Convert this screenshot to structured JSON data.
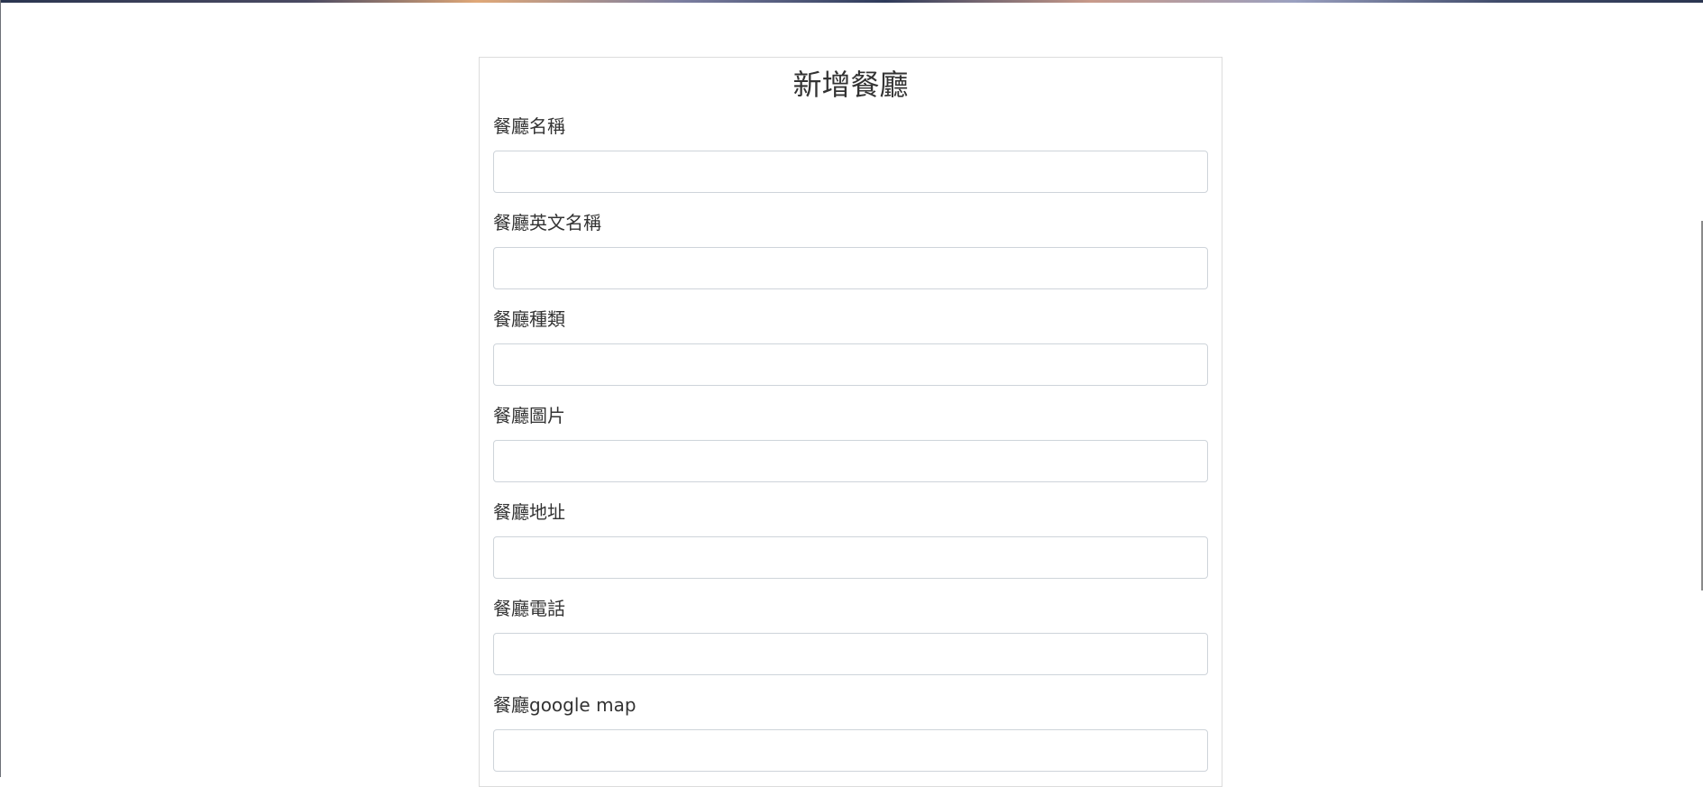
{
  "form": {
    "title": "新增餐廳",
    "fields": [
      {
        "label": "餐廳名稱",
        "value": "",
        "placeholder": ""
      },
      {
        "label": "餐廳英文名稱",
        "value": "",
        "placeholder": ""
      },
      {
        "label": "餐廳種類",
        "value": "",
        "placeholder": ""
      },
      {
        "label": "餐廳圖片",
        "value": "",
        "placeholder": ""
      },
      {
        "label": "餐廳地址",
        "value": "",
        "placeholder": ""
      },
      {
        "label": "餐廳電話",
        "value": "",
        "placeholder": ""
      },
      {
        "label": "餐廳google map",
        "value": "",
        "placeholder": ""
      }
    ]
  }
}
